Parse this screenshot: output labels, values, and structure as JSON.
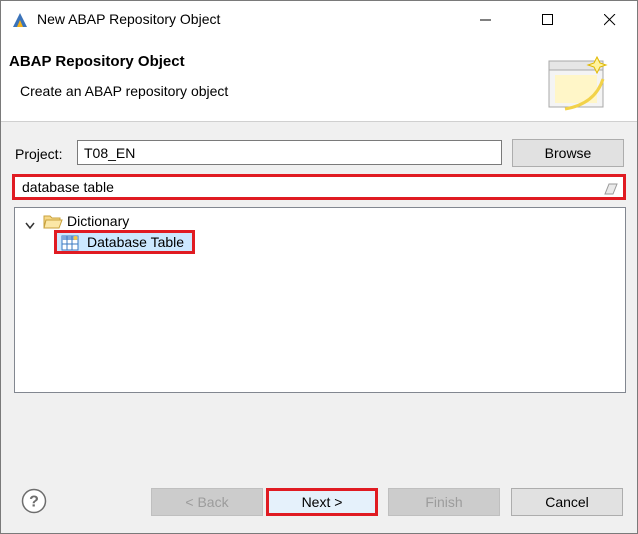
{
  "window": {
    "title": "New ABAP Repository Object",
    "controls": [
      "minimize",
      "maximize",
      "close"
    ]
  },
  "banner": {
    "title": "ABAP Repository Object",
    "description": "Create an ABAP repository object"
  },
  "project": {
    "label": "Project:",
    "value": "T08_EN",
    "browse_label": "Browse"
  },
  "search": {
    "value": "database table"
  },
  "tree": {
    "folder": {
      "label": "Dictionary",
      "expanded": true,
      "icon": "folder-open-icon"
    },
    "items": [
      {
        "label": "Database Table",
        "icon": "database-table-icon",
        "selected": true
      }
    ]
  },
  "footer": {
    "back_label": "< Back",
    "next_label": "Next >",
    "finish_label": "Finish",
    "cancel_label": "Cancel",
    "help_icon": "help-icon"
  },
  "colors": {
    "highlight": "#e01b22",
    "selection": "#cce8ff"
  }
}
